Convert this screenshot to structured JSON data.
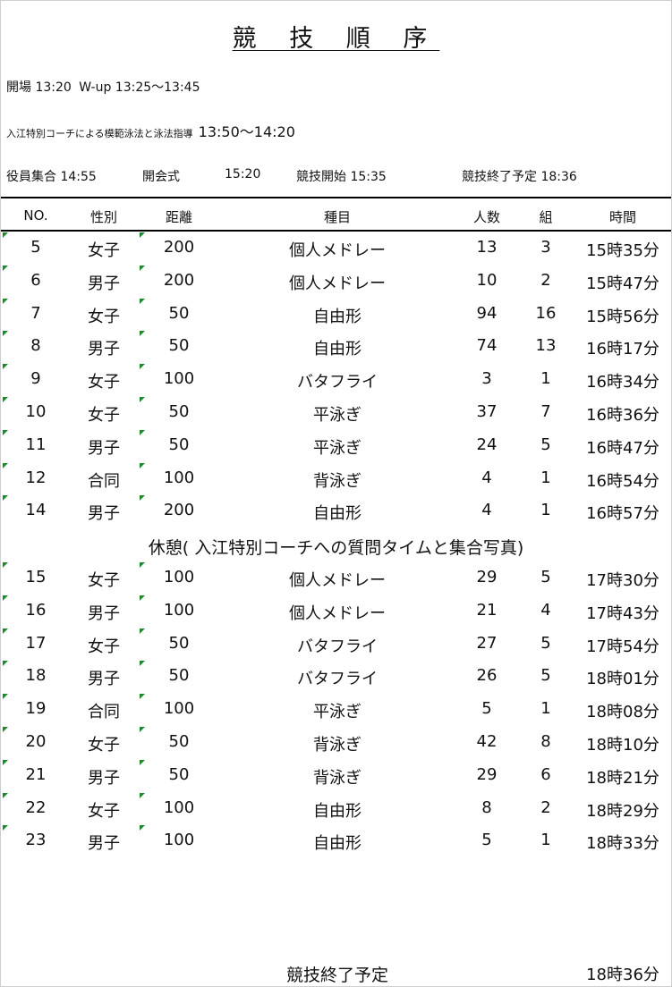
{
  "title": "競 技 順 序",
  "schedule": {
    "open": "開場 13:20",
    "warmup": "W-up 13:25〜13:45",
    "clinic_label": "入江特別コーチによる模範泳法と泳法指導",
    "clinic_time": "13:50〜14:20",
    "staff": "役員集合 14:55",
    "opening": "開会式",
    "opening_time": "15:20",
    "start": "競技開始 15:35",
    "end_planned": "競技終了予定 18:36"
  },
  "table": {
    "headers": {
      "no": "NO.",
      "gender": "性別",
      "distance": "距離",
      "event": "種目",
      "count": "人数",
      "heats": "組",
      "time": "時間"
    },
    "rows_a": [
      {
        "no": "5",
        "gender": "女子",
        "distance": "200",
        "event": "個人メドレー",
        "count": "13",
        "heats": "3",
        "time": "15時35分"
      },
      {
        "no": "6",
        "gender": "男子",
        "distance": "200",
        "event": "個人メドレー",
        "count": "10",
        "heats": "2",
        "time": "15時47分"
      },
      {
        "no": "7",
        "gender": "女子",
        "distance": "50",
        "event": "自由形",
        "count": "94",
        "heats": "16",
        "time": "15時56分"
      },
      {
        "no": "8",
        "gender": "男子",
        "distance": "50",
        "event": "自由形",
        "count": "74",
        "heats": "13",
        "time": "16時17分"
      },
      {
        "no": "9",
        "gender": "女子",
        "distance": "100",
        "event": "バタフライ",
        "count": "3",
        "heats": "1",
        "time": "16時34分"
      },
      {
        "no": "10",
        "gender": "女子",
        "distance": "50",
        "event": "平泳ぎ",
        "count": "37",
        "heats": "7",
        "time": "16時36分"
      },
      {
        "no": "11",
        "gender": "男子",
        "distance": "50",
        "event": "平泳ぎ",
        "count": "24",
        "heats": "5",
        "time": "16時47分"
      },
      {
        "no": "12",
        "gender": "合同",
        "distance": "100",
        "event": "背泳ぎ",
        "count": "4",
        "heats": "1",
        "time": "16時54分"
      },
      {
        "no": "14",
        "gender": "男子",
        "distance": "200",
        "event": "自由形",
        "count": "4",
        "heats": "1",
        "time": "16時57分"
      }
    ],
    "break_label": "休憩( 入江特別コーチへの質問タイムと集合写真)",
    "rows_b": [
      {
        "no": "15",
        "gender": "女子",
        "distance": "100",
        "event": "個人メドレー",
        "count": "29",
        "heats": "5",
        "time": "17時30分"
      },
      {
        "no": "16",
        "gender": "男子",
        "distance": "100",
        "event": "個人メドレー",
        "count": "21",
        "heats": "4",
        "time": "17時43分"
      },
      {
        "no": "17",
        "gender": "女子",
        "distance": "50",
        "event": "バタフライ",
        "count": "27",
        "heats": "5",
        "time": "17時54分"
      },
      {
        "no": "18",
        "gender": "男子",
        "distance": "50",
        "event": "バタフライ",
        "count": "26",
        "heats": "5",
        "time": "18時01分"
      },
      {
        "no": "19",
        "gender": "合同",
        "distance": "100",
        "event": "平泳ぎ",
        "count": "5",
        "heats": "1",
        "time": "18時08分"
      },
      {
        "no": "20",
        "gender": "女子",
        "distance": "50",
        "event": "背泳ぎ",
        "count": "42",
        "heats": "8",
        "time": "18時10分"
      },
      {
        "no": "21",
        "gender": "男子",
        "distance": "50",
        "event": "背泳ぎ",
        "count": "29",
        "heats": "6",
        "time": "18時21分"
      },
      {
        "no": "22",
        "gender": "女子",
        "distance": "100",
        "event": "自由形",
        "count": "8",
        "heats": "2",
        "time": "18時29分"
      },
      {
        "no": "23",
        "gender": "男子",
        "distance": "100",
        "event": "自由形",
        "count": "5",
        "heats": "1",
        "time": "18時33分"
      }
    ]
  },
  "footer": {
    "label": "競技終了予定",
    "time": "18時36分"
  },
  "colors": {
    "marker": "#1a8a2a",
    "text": "#111111"
  }
}
